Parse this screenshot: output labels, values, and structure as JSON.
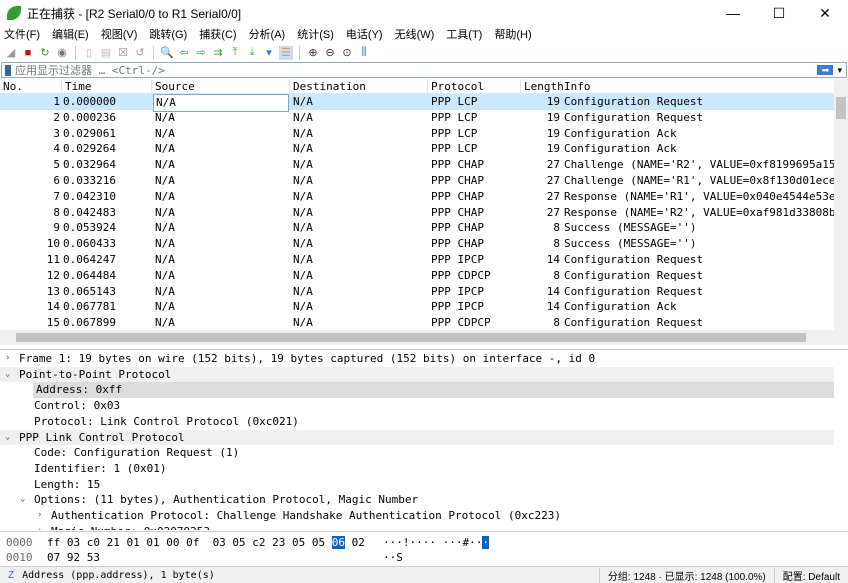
{
  "window": {
    "title": "正在捕获 - [R2 Serial0/0 to R1 Serial0/0]",
    "minimize": "—",
    "maximize": "☐",
    "close": "✕"
  },
  "menu": [
    "文件(F)",
    "编辑(E)",
    "视图(V)",
    "跳转(G)",
    "捕获(C)",
    "分析(A)",
    "统计(S)",
    "电话(Y)",
    "无线(W)",
    "工具(T)",
    "帮助(H)"
  ],
  "toolbar": [
    "shark-fin-icon",
    "stop-icon",
    "restart-icon",
    "options-icon",
    "open-icon",
    "file-icon",
    "close-file-icon",
    "reload-icon",
    "find-icon",
    "back-icon",
    "forward-icon",
    "goto-icon",
    "first-icon",
    "last-icon",
    "autoscroll-icon",
    "colorize-icon",
    "zoom-in-icon",
    "zoom-out-icon",
    "zoom-reset-icon",
    "resize-columns-icon"
  ],
  "filter": {
    "placeholder": "应用显示过滤器 … <Ctrl-/>"
  },
  "columns": [
    "No.",
    "Time",
    "Source",
    "Destination",
    "Protocol",
    "Length",
    "Info"
  ],
  "packets": [
    [
      "1",
      "0.000000",
      "N/A",
      "N/A",
      "PPP LCP",
      "19",
      "Configuration Request"
    ],
    [
      "2",
      "0.000236",
      "N/A",
      "N/A",
      "PPP LCP",
      "19",
      "Configuration Request"
    ],
    [
      "3",
      "0.029061",
      "N/A",
      "N/A",
      "PPP LCP",
      "19",
      "Configuration Ack"
    ],
    [
      "4",
      "0.029264",
      "N/A",
      "N/A",
      "PPP LCP",
      "19",
      "Configuration Ack"
    ],
    [
      "5",
      "0.032964",
      "N/A",
      "N/A",
      "PPP CHAP",
      "27",
      "Challenge (NAME='R2', VALUE=0xf8199695a15"
    ],
    [
      "6",
      "0.033216",
      "N/A",
      "N/A",
      "PPP CHAP",
      "27",
      "Challenge (NAME='R1', VALUE=0x8f130d01ece"
    ],
    [
      "7",
      "0.042310",
      "N/A",
      "N/A",
      "PPP CHAP",
      "27",
      "Response (NAME='R1', VALUE=0x040e4544e53e"
    ],
    [
      "8",
      "0.042483",
      "N/A",
      "N/A",
      "PPP CHAP",
      "27",
      "Response (NAME='R2', VALUE=0xaf981d33808b"
    ],
    [
      "9",
      "0.053924",
      "N/A",
      "N/A",
      "PPP CHAP",
      "8",
      "Success (MESSAGE='')"
    ],
    [
      "10",
      "0.060433",
      "N/A",
      "N/A",
      "PPP CHAP",
      "8",
      "Success (MESSAGE='')"
    ],
    [
      "11",
      "0.064247",
      "N/A",
      "N/A",
      "PPP IPCP",
      "14",
      "Configuration Request"
    ],
    [
      "12",
      "0.064484",
      "N/A",
      "N/A",
      "PPP CDPCP",
      "8",
      "Configuration Request"
    ],
    [
      "13",
      "0.065143",
      "N/A",
      "N/A",
      "PPP IPCP",
      "14",
      "Configuration Request"
    ],
    [
      "14",
      "0.067781",
      "N/A",
      "N/A",
      "PPP IPCP",
      "14",
      "Configuration Ack"
    ],
    [
      "15",
      "0.067899",
      "N/A",
      "N/A",
      "PPP CDPCP",
      "8",
      "Configuration Request"
    ]
  ],
  "details": [
    {
      "t": ">",
      "i": 0,
      "text": "Frame 1: 19 bytes on wire (152 bits), 19 bytes captured (152 bits) on interface -, id 0"
    },
    {
      "t": "v",
      "i": 0,
      "text": "Point-to-Point Protocol",
      "hl": true
    },
    {
      "t": "",
      "i": 1,
      "text": "Address: 0xff",
      "sel": true
    },
    {
      "t": "",
      "i": 1,
      "text": "Control: 0x03"
    },
    {
      "t": "",
      "i": 1,
      "text": "Protocol: Link Control Protocol (0xc021)"
    },
    {
      "t": "v",
      "i": 0,
      "text": "PPP Link Control Protocol",
      "hl": true
    },
    {
      "t": "",
      "i": 1,
      "text": "Code: Configuration Request (1)"
    },
    {
      "t": "",
      "i": 1,
      "text": "Identifier: 1 (0x01)"
    },
    {
      "t": "",
      "i": 1,
      "text": "Length: 15"
    },
    {
      "t": "v",
      "i": 1,
      "text": "Options: (11 bytes), Authentication Protocol, Magic Number"
    },
    {
      "t": ">",
      "i": 2,
      "text": "Authentication Protocol: Challenge Handshake Authentication Protocol (0xc223)"
    },
    {
      "t": ">",
      "i": 2,
      "text": "Magic Number: 0x02079253"
    }
  ],
  "hex": [
    {
      "offset": "0000",
      "pre": "ff 03 c0 21 01 01 00 0f  03 05 c2 23 05 05 ",
      "sel": "06",
      "post": " 02",
      "ascii_pre": "···!···· ···#··",
      "ascii_sel": "·",
      "ascii_post": ""
    },
    {
      "offset": "0010",
      "pre": "07 92 53",
      "sel": "",
      "post": "",
      "ascii_pre": "··S",
      "ascii_sel": "",
      "ascii_post": ""
    }
  ],
  "status": {
    "field": "Address (ppp.address), 1 byte(s)",
    "packets": "分组: 1248 · 已显示: 1248 (100.0%)",
    "profile": "配置: Default"
  }
}
